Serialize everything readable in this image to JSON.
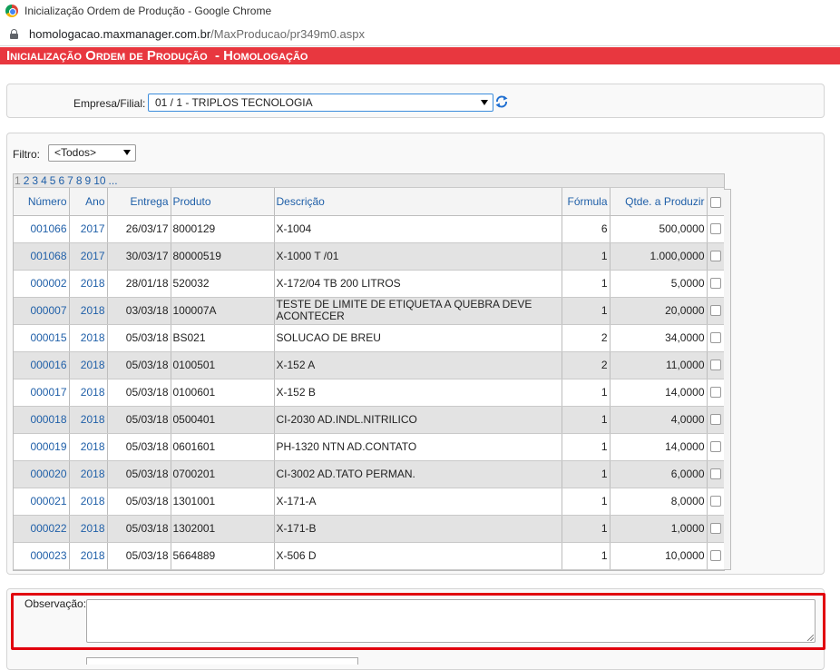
{
  "window": {
    "title": "Inicialização Ordem de Produção - Google Chrome",
    "url_host": "homologacao.maxmanager.com.br",
    "url_path": "/MaxProducao/pr349m0.aspx"
  },
  "header": {
    "title": "Inicialização Ordem de Produção  - Homologação"
  },
  "company": {
    "label": "Empresa/Filial:",
    "selected": "01 / 1 - TRIPLOS TECNOLOGIA"
  },
  "filter": {
    "label": "Filtro:",
    "selected": "<Todos>"
  },
  "pager": {
    "pages": [
      "1",
      "2",
      "3",
      "4",
      "5",
      "6",
      "7",
      "8",
      "9",
      "10",
      "..."
    ]
  },
  "grid": {
    "columns": {
      "numero": "Número",
      "ano": "Ano",
      "entrega": "Entrega",
      "produto": "Produto",
      "descricao": "Descrição",
      "formula": "Fórmula",
      "qtde": "Qtde. a Produzir"
    },
    "rows": [
      {
        "numero": "001066",
        "ano": "2017",
        "entrega": "26/03/17",
        "produto": "8000129",
        "descricao": "X-1004",
        "formula": "6",
        "qtde": "500,0000"
      },
      {
        "numero": "001068",
        "ano": "2017",
        "entrega": "30/03/17",
        "produto": "80000519",
        "descricao": "X-1000 T /01",
        "formula": "1",
        "qtde": "1.000,0000"
      },
      {
        "numero": "000002",
        "ano": "2018",
        "entrega": "28/01/18",
        "produto": "520032",
        "descricao": "X-172/04 TB 200 LITROS",
        "formula": "1",
        "qtde": "5,0000"
      },
      {
        "numero": "000007",
        "ano": "2018",
        "entrega": "03/03/18",
        "produto": "100007A",
        "descricao": "TESTE DE LIMITE DE ETIQUETA A QUEBRA DEVE ACONTECER",
        "formula": "1",
        "qtde": "20,0000"
      },
      {
        "numero": "000015",
        "ano": "2018",
        "entrega": "05/03/18",
        "produto": "BS021",
        "descricao": "SOLUCAO DE BREU",
        "formula": "2",
        "qtde": "34,0000"
      },
      {
        "numero": "000016",
        "ano": "2018",
        "entrega": "05/03/18",
        "produto": "0100501",
        "descricao": "X-152 A",
        "formula": "2",
        "qtde": "11,0000"
      },
      {
        "numero": "000017",
        "ano": "2018",
        "entrega": "05/03/18",
        "produto": "0100601",
        "descricao": "X-152 B",
        "formula": "1",
        "qtde": "14,0000"
      },
      {
        "numero": "000018",
        "ano": "2018",
        "entrega": "05/03/18",
        "produto": "0500401",
        "descricao": "CI-2030 AD.INDL.NITRILICO",
        "formula": "1",
        "qtde": "4,0000"
      },
      {
        "numero": "000019",
        "ano": "2018",
        "entrega": "05/03/18",
        "produto": "0601601",
        "descricao": "PH-1320 NTN AD.CONTATO",
        "formula": "1",
        "qtde": "14,0000"
      },
      {
        "numero": "000020",
        "ano": "2018",
        "entrega": "05/03/18",
        "produto": "0700201",
        "descricao": "CI-3002 AD.TATO PERMAN.",
        "formula": "1",
        "qtde": "6,0000"
      },
      {
        "numero": "000021",
        "ano": "2018",
        "entrega": "05/03/18",
        "produto": "1301001",
        "descricao": "X-171-A",
        "formula": "1",
        "qtde": "8,0000"
      },
      {
        "numero": "000022",
        "ano": "2018",
        "entrega": "05/03/18",
        "produto": "1302001",
        "descricao": "X-171-B",
        "formula": "1",
        "qtde": "1,0000"
      },
      {
        "numero": "000023",
        "ano": "2018",
        "entrega": "05/03/18",
        "produto": "5664889",
        "descricao": "X-506 D",
        "formula": "1",
        "qtde": "10,0000"
      }
    ]
  },
  "observation": {
    "label": "Observação:",
    "value": ""
  },
  "colors": {
    "header_bg": "#e8373f",
    "link": "#1f5fa8",
    "highlight_border": "#e1000e",
    "alt_row": "#e3e3e3"
  },
  "icons": {
    "browser": "chrome-logo-icon",
    "secure": "lock-icon",
    "refresh": "refresh-icon",
    "dropdown": "chevron-down-icon"
  }
}
